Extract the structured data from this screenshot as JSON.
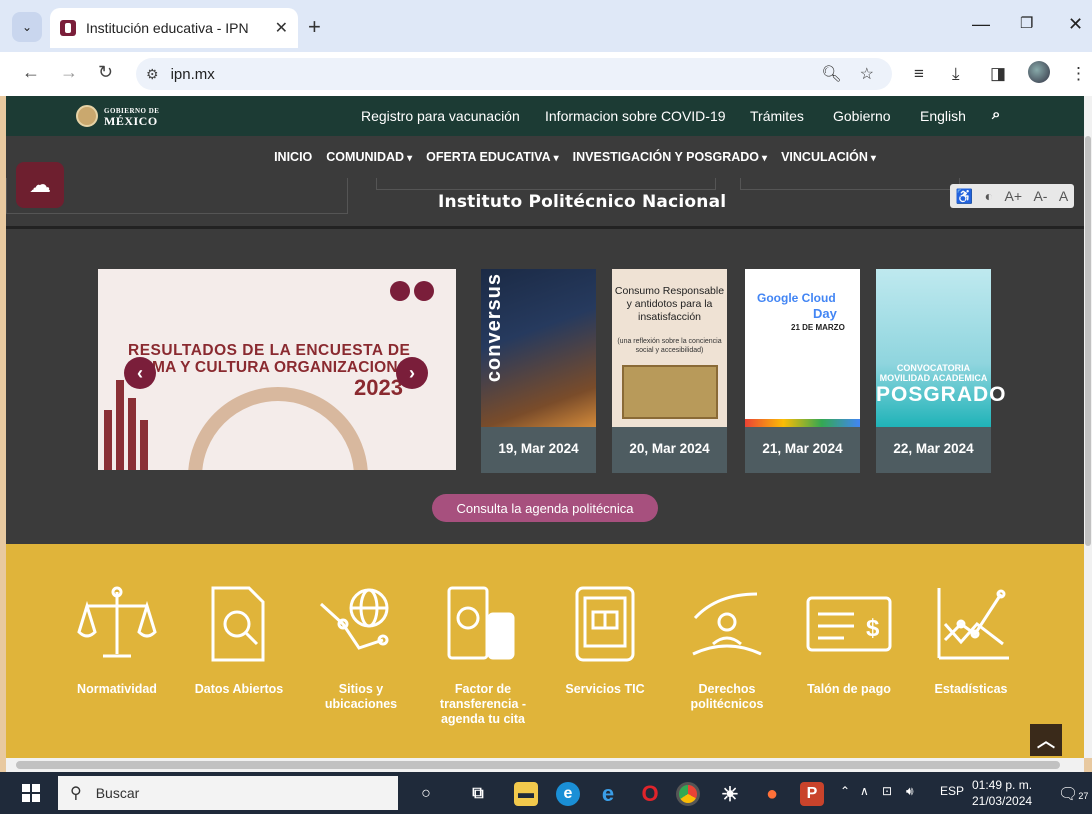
{
  "browser": {
    "tab_title": "Institución educativa - IPN",
    "url": "ipn.mx"
  },
  "gov_bar": {
    "logo_top": "GOBIERNO DE",
    "logo_main": "MÉXICO",
    "links": [
      "Registro para vacunación",
      "Informacion sobre COVID-19",
      "Trámites",
      "Gobierno",
      "English"
    ]
  },
  "main_nav": {
    "items": [
      {
        "label": "INICIO",
        "dropdown": false
      },
      {
        "label": "COMUNIDAD",
        "dropdown": true
      },
      {
        "label": "OFERTA EDUCATIVA",
        "dropdown": true
      },
      {
        "label": "INVESTIGACIÓN Y POSGRADO",
        "dropdown": true
      },
      {
        "label": "VINCULACIÓN",
        "dropdown": true
      }
    ]
  },
  "header": {
    "institute_title": "Instituto Politécnico Nacional",
    "a11y": [
      "A+",
      "A-",
      "A"
    ]
  },
  "slider": {
    "line1": "RESULTADOS DE LA ENCUESTA DE",
    "line2": "MA Y CULTURA ORGANIZACION",
    "year": "2023"
  },
  "events": [
    {
      "date": "19, Mar 2024",
      "image_text": "conversus"
    },
    {
      "date": "20, Mar 2024",
      "image_title": "Consumo Responsable y antidotos para la insatisfacción",
      "image_sub": "(una reflexión sobre la conciencia social y accesibilidad)"
    },
    {
      "date": "21, Mar 2024",
      "image_title": "Google Cloud",
      "image_title2": "Day",
      "image_sub": "21 DE MARZO"
    },
    {
      "date": "22, Mar 2024",
      "image_title": "CONVOCATORIA MOVILIDAD ACADEMICA",
      "image_sub": "POSGRADO"
    }
  ],
  "agenda_button": "Consulta la agenda politécnica",
  "services": [
    {
      "label": "Normatividad",
      "icon": "scales-icon"
    },
    {
      "label": "Datos Abiertos",
      "icon": "document-magnifier-icon"
    },
    {
      "label": "Sitios y ubicaciones",
      "icon": "globe-map-icon"
    },
    {
      "label": "Factor de transferencia - agenda tu cita",
      "icon": "medicine-bottle-icon"
    },
    {
      "label": "Servicios TIC",
      "icon": "tablet-book-icon"
    },
    {
      "label": "Derechos politécnicos",
      "icon": "hands-person-icon"
    },
    {
      "label": "Talón de pago",
      "icon": "paycheck-icon"
    },
    {
      "label": "Estadísticas",
      "icon": "line-chart-icon"
    }
  ],
  "taskbar": {
    "search_placeholder": "Buscar",
    "language": "ESP",
    "time": "01:49 p. m.",
    "date": "21/03/2024",
    "notifications": "27"
  },
  "colors": {
    "gov_green": "#1c3b34",
    "ipn_guinda": "#7a1e3a",
    "section_yellow": "#e0b43a",
    "agenda_pink": "#a7507e"
  }
}
